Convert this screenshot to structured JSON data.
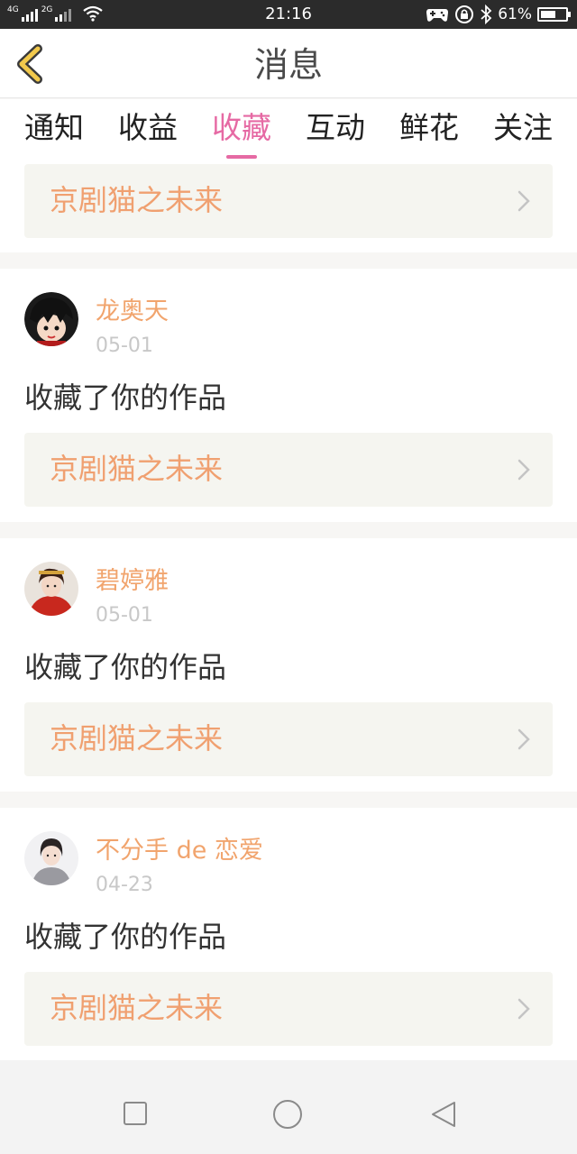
{
  "status_bar": {
    "network1": "4G",
    "network2": "2G",
    "time": "21:16",
    "battery_percent_text": "61%",
    "battery_level": 0.61
  },
  "header": {
    "title": "消息",
    "accent_color": "#f2c94c"
  },
  "tabs": [
    {
      "label": "通知",
      "active": false
    },
    {
      "label": "收益",
      "active": false
    },
    {
      "label": "收藏",
      "active": true
    },
    {
      "label": "互动",
      "active": false
    },
    {
      "label": "鲜花",
      "active": false
    },
    {
      "label": "关注",
      "active": false
    }
  ],
  "feed": {
    "partial_item": {
      "work_title": "京剧猫之未来"
    },
    "items": [
      {
        "user": "龙奥天",
        "date": "05-01",
        "action": "收藏了你的作品",
        "work_title": "京剧猫之未来",
        "avatar": "cartoon-boy-avatar"
      },
      {
        "user": "碧婷雅",
        "date": "05-01",
        "action": "收藏了你的作品",
        "work_title": "京剧猫之未来",
        "avatar": "girl-red-dress-avatar"
      },
      {
        "user": "不分手 de 恋爱",
        "date": "04-23",
        "action": "收藏了你的作品",
        "work_title": "京剧猫之未来",
        "avatar": "girl-photo-avatar"
      }
    ]
  },
  "colors": {
    "active_tab": "#e66aa4",
    "username": "#f1a46d",
    "work_title": "#f0a070"
  },
  "nav_bar": {
    "buttons": [
      "recent-apps",
      "home",
      "back"
    ]
  }
}
